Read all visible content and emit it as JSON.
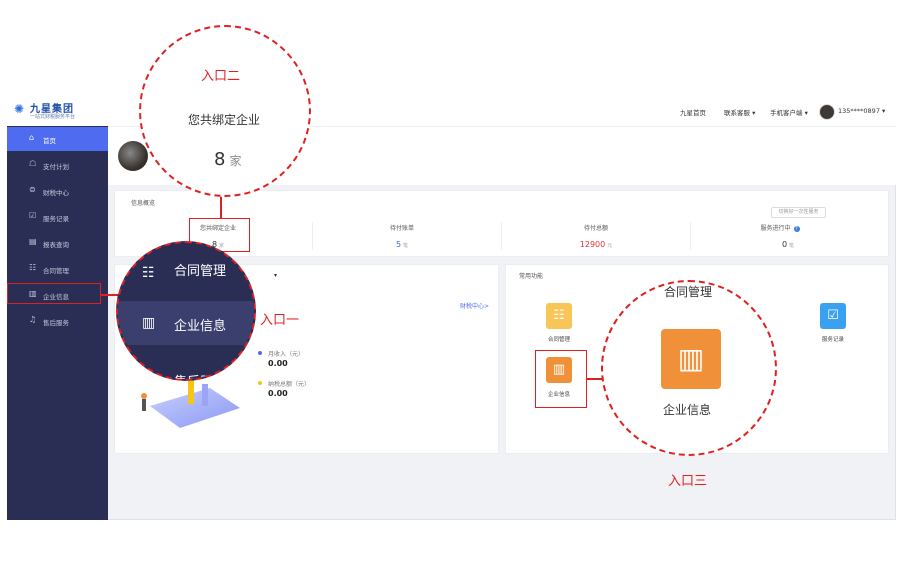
{
  "brand": {
    "name": "九星集团",
    "tagline": "一站式财税服务平台"
  },
  "sidebar": {
    "items": [
      {
        "label": "首页",
        "icon": "home-icon",
        "glyph": "⌂"
      },
      {
        "label": "支付计划",
        "icon": "payment-plan-icon",
        "glyph": "☖"
      },
      {
        "label": "财税中心",
        "icon": "tax-center-icon",
        "glyph": "⊜"
      },
      {
        "label": "服务记录",
        "icon": "record-icon",
        "glyph": "☑"
      },
      {
        "label": "报表查询",
        "icon": "report-icon",
        "glyph": "▤"
      },
      {
        "label": "合同管理",
        "icon": "contract-icon",
        "glyph": "☷"
      },
      {
        "label": "企业信息",
        "icon": "company-icon",
        "glyph": "▥"
      },
      {
        "label": "售后服务",
        "icon": "service-icon",
        "glyph": "♫"
      }
    ]
  },
  "header": {
    "home": "九星首页",
    "contact": "联系客服 ▾",
    "mobile": "手机客户端 ▾",
    "user": "135****0897 ▾"
  },
  "overview": {
    "title": "信息概览",
    "button": "切换好一次性服务",
    "stats": [
      {
        "label": "您共绑定企业",
        "value": "8",
        "unit": "家",
        "color": "#333333"
      },
      {
        "label": "待付账单",
        "value": "5",
        "unit": "笔",
        "color": "#3a6fd8"
      },
      {
        "label": "待付总额",
        "value": "12900",
        "unit": "元",
        "color": "#e63232"
      },
      {
        "label": "服务进行中",
        "value": "0",
        "unit": "笔",
        "color": "#333333"
      }
    ]
  },
  "finance": {
    "dropdown_arrow": "▾",
    "link": "财税中心>",
    "legend": [
      {
        "label": "月收入（元）",
        "value": "0.00",
        "color": "#4f6cf0"
      },
      {
        "label": "纳税总额（元）",
        "value": "0.00",
        "color": "#f5c518"
      }
    ]
  },
  "functions": {
    "title": "常用功能",
    "items": [
      {
        "label": "合同管理",
        "color": "#f7c656",
        "glyph": "☷"
      },
      {
        "label": "企业信息",
        "color": "#f0913a",
        "glyph": "▥"
      },
      {
        "label": "服务记录",
        "color": "#3aa0f0",
        "glyph": "☑"
      }
    ]
  },
  "callouts": {
    "entry1": "入口一",
    "entry2": "入口二",
    "entry3": "入口三",
    "c2_text": "您共绑定企业",
    "c2_value": "8",
    "c2_unit": "家",
    "c1_items": [
      "合同管理",
      "企业信息",
      "售后服务"
    ],
    "c3_top": "合同管理",
    "c3_label": "企业信息"
  }
}
